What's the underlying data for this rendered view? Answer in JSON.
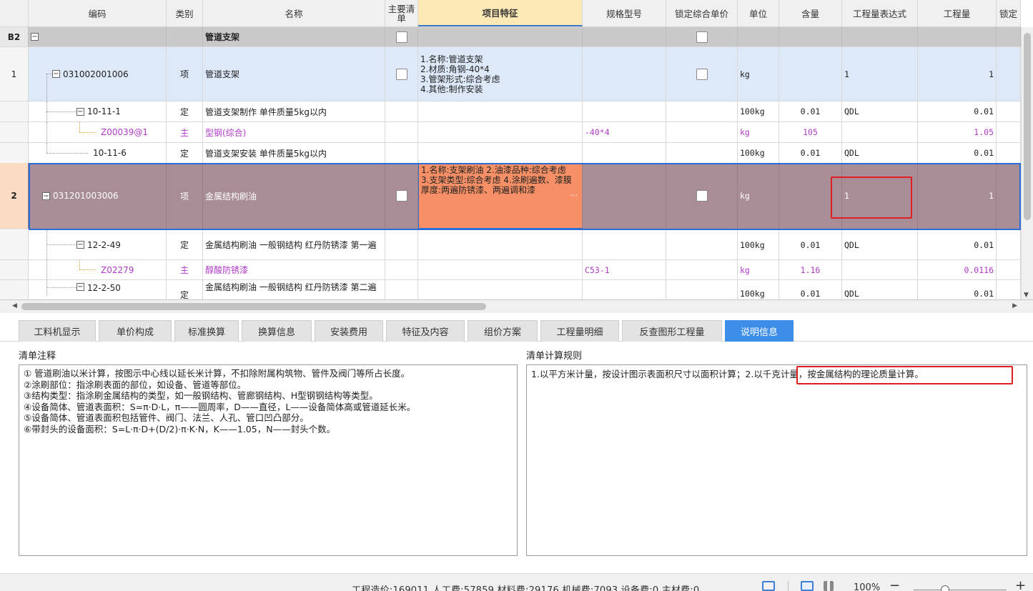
{
  "grid": {
    "headers": [
      "",
      "编码",
      "类别",
      "名称",
      "主要清单",
      "项目特征",
      "规格型号",
      "锁定综合单价",
      "单位",
      "含量",
      "工程量表达式",
      "工程量",
      "锁定"
    ],
    "rows": {
      "b2": {
        "num": "B2",
        "name": "管道支架"
      },
      "r1": {
        "num": "1",
        "code": "031002001006",
        "type": "项",
        "name": "管道支架",
        "features": [
          "1.名称:管道支架",
          "2.材质:角钢-40*4",
          "3.管架形式:综合考虑",
          "4.其他:制作安装"
        ],
        "unit": "kg",
        "expr": "1",
        "qty": "1"
      },
      "r1a": {
        "code": "10-11-1",
        "type": "定",
        "name": "管道支架制作 单件质量5kg以内",
        "unit": "100kg",
        "content": "0.01",
        "expr": "QDL",
        "qty": "0.01"
      },
      "r1b": {
        "code": "Z00039@1",
        "type": "主",
        "name": "型钢(综合)",
        "spec": "-40*4",
        "unit": "kg",
        "content": "105",
        "qty": "1.05"
      },
      "r1c": {
        "code": "10-11-6",
        "type": "定",
        "name": "管道支架安装 单件质量5kg以内",
        "unit": "100kg",
        "content": "0.01",
        "expr": "QDL",
        "qty": "0.01"
      },
      "r2": {
        "num": "2",
        "code": "031201003006",
        "type": "项",
        "name": "金属结构刷油",
        "features": "1.名称:支架刷油 2.油漆品种:综合考虑 3.支架类型:综合考虑 4.涂刷遍数、漆膜厚度:两遍防锈漆、两遍调和漆",
        "more": "···",
        "unit": "kg",
        "expr": "1",
        "qty": "1"
      },
      "r2a": {
        "code": "12-2-49",
        "type": "定",
        "name": "金属结构刷油 一般钢结构 红丹防锈漆 第一遍",
        "unit": "100kg",
        "content": "0.01",
        "expr": "QDL",
        "qty": "0.01"
      },
      "r2b": {
        "code": "Z02279",
        "type": "主",
        "name": "醇酸防锈漆",
        "spec": "C53-1",
        "unit": "kg",
        "content": "1.16",
        "qty": "0.0116"
      },
      "r2c": {
        "code": "12-2-50",
        "type": "定",
        "name": "金属结构刷油 一般钢结构 红丹防锈漆 第二遍",
        "unit": "100kg",
        "content": "0.01",
        "expr": "QDL",
        "qty": "0.01"
      }
    }
  },
  "tabs": [
    "工料机显示",
    "单价构成",
    "标准换算",
    "换算信息",
    "安装费用",
    "特征及内容",
    "组价方案",
    "工程量明细",
    "反查图形工程量",
    "说明信息"
  ],
  "active_tab": "说明信息",
  "notes": {
    "title": "清单注释",
    "lines": [
      "① 管道刷油以米计算，按图示中心线以延长米计算，不扣除附属构筑物、管件及阀门等所占长度。",
      "②涂刷部位：指涂刷表面的部位，如设备、管道等部位。",
      "③结构类型：指涂刷金属结构的类型，如一般钢结构、管廊钢结构、H型钢钢结构等类型。",
      "④设备简体、管道表面积：S=π·D·L，π——圆周率，D——直径，L——设备简体高或管道延长米。",
      "⑤设备简体、管道表面积包括管件、阀门、法兰、人孔、管口凹凸部分。",
      "⑥带封头的设备面积：S=L·π·D+(D/2)·π·K·N，K——1.05，N——封头个数。"
    ]
  },
  "rules": {
    "title": "清单计算规则",
    "text": "1.以平方米计量，按设计图示表面积尺寸以面积计算；2.以千克计量，按金属结构的理论质量计算。"
  },
  "status": {
    "summary": "工程造价:169011  人工费:57859  材料费:29176  机械费:7093  设备费:0  主材费:0",
    "zoom": "100%"
  },
  "colors": {
    "accent": "#3d8ee8",
    "selected_row": "#a88c96",
    "feature_highlight": "#f79066",
    "annotation": "#e02020",
    "main_material": "#b03cc8"
  }
}
